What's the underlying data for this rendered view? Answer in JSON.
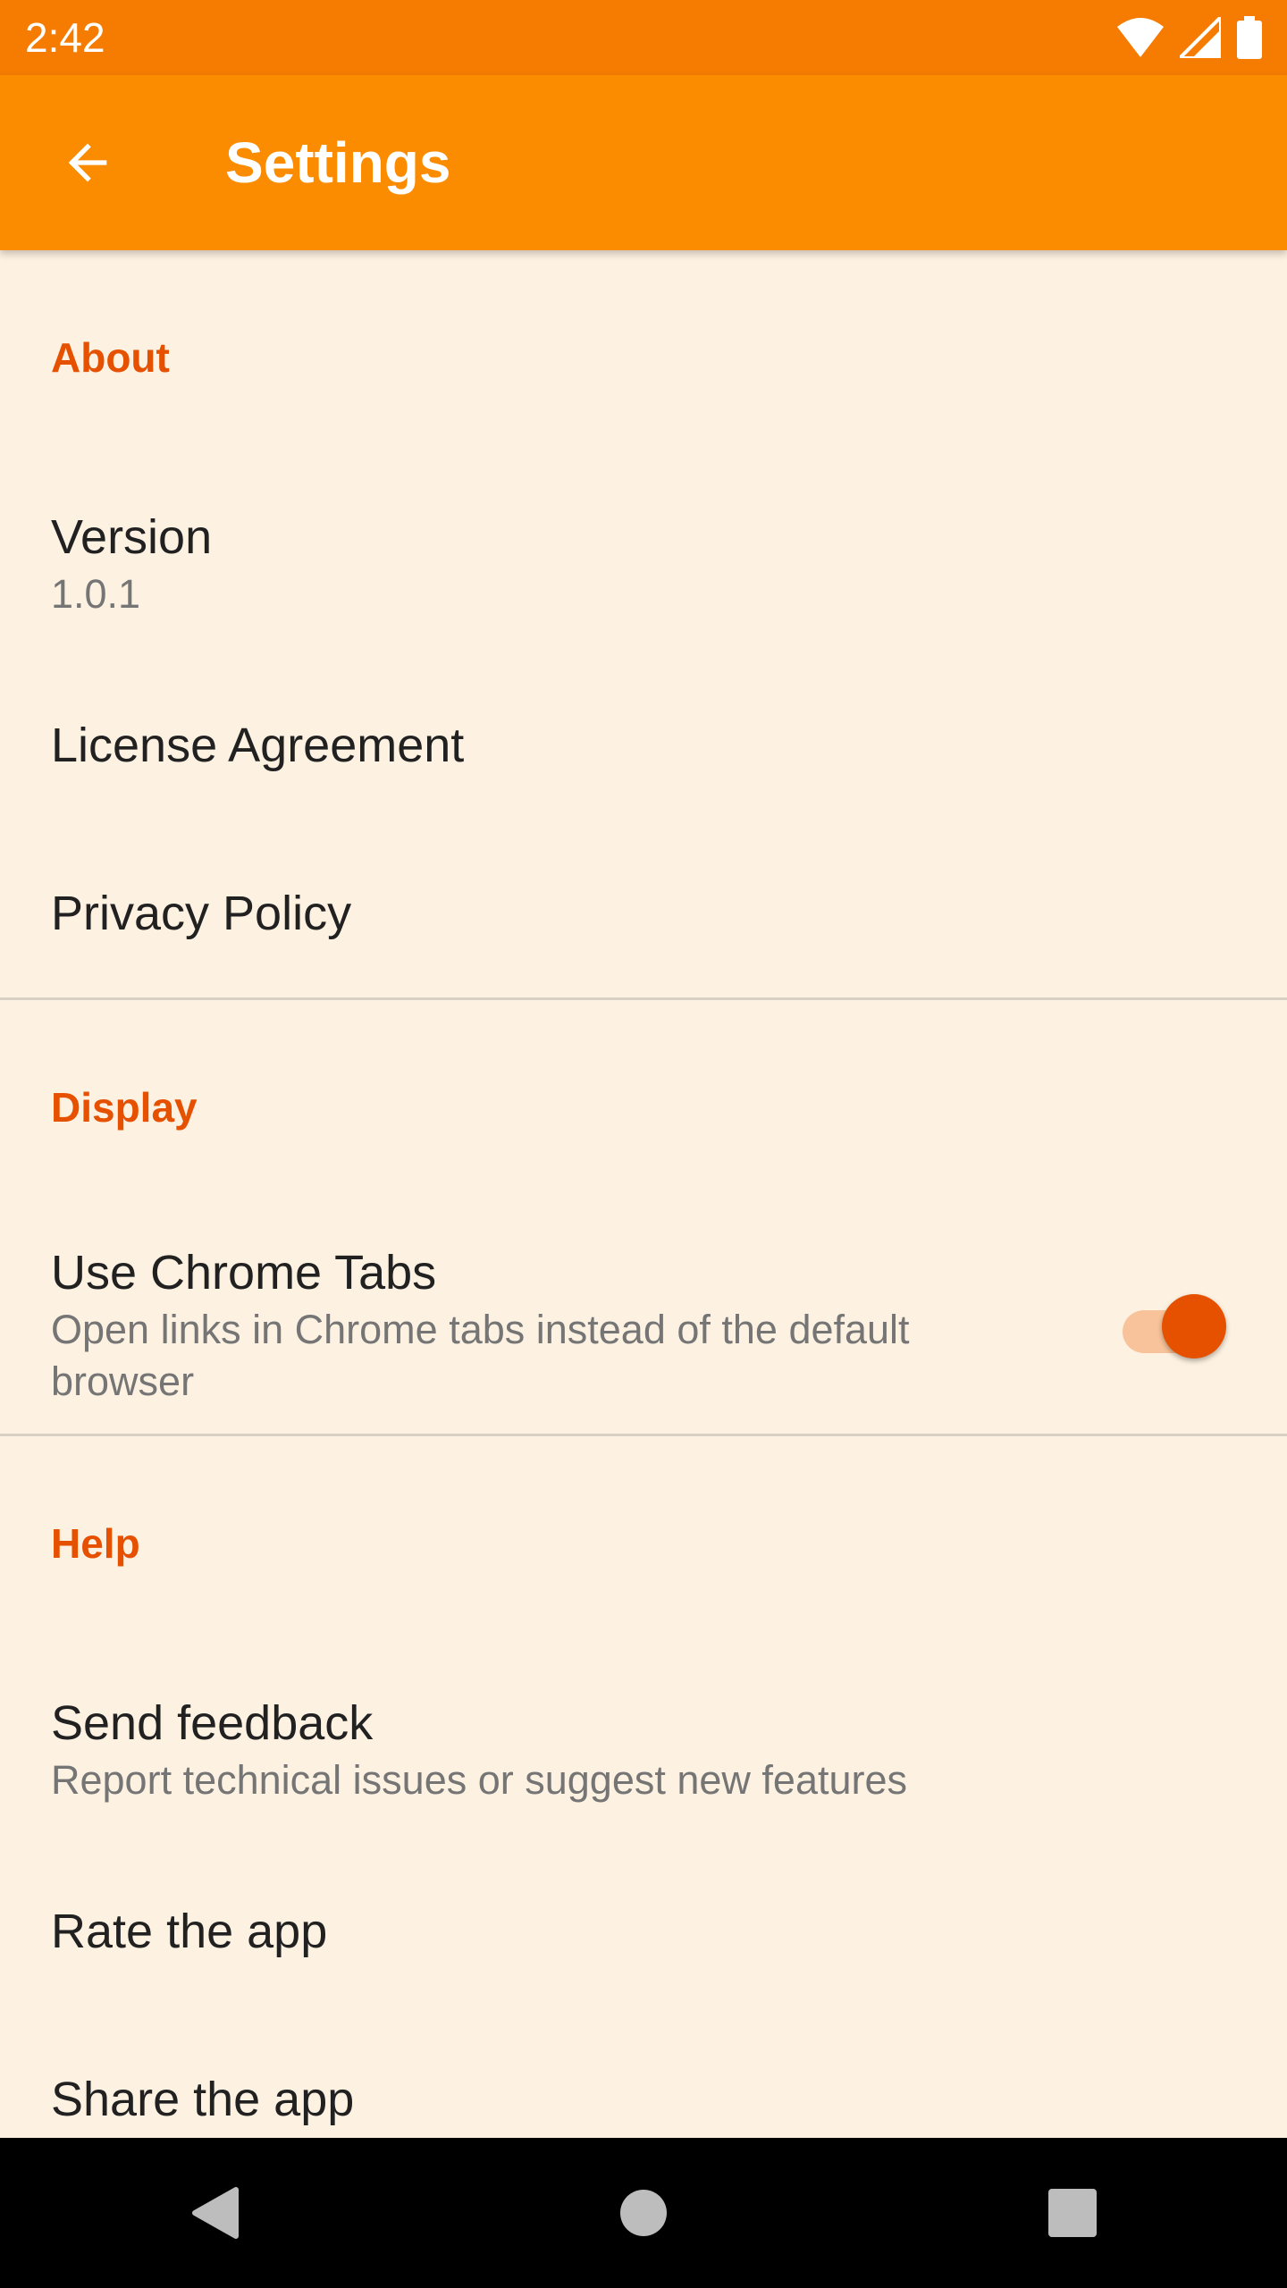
{
  "status_bar": {
    "time": "2:42",
    "icons": [
      "wifi-icon",
      "signal-icon",
      "battery-icon"
    ]
  },
  "app_bar": {
    "back_icon": "arrow-back-icon",
    "title": "Settings",
    "background": "#FB8C00"
  },
  "sections": {
    "about": {
      "header": "About",
      "version": {
        "title": "Version",
        "summary": "1.0.1"
      },
      "license": {
        "title": "License Agreement"
      },
      "privacy": {
        "title": "Privacy Policy"
      }
    },
    "display": {
      "header": "Display",
      "chrome_tabs": {
        "title": "Use Chrome Tabs",
        "summary": "Open links in Chrome tabs instead of the default browser",
        "enabled": true
      }
    },
    "help": {
      "header": "Help",
      "feedback": {
        "title": "Send feedback",
        "summary": "Report technical issues or suggest new features"
      },
      "rate": {
        "title": "Rate the app"
      },
      "share": {
        "title": "Share the app"
      }
    }
  },
  "nav_bar": {
    "icons": [
      "back-triangle-icon",
      "home-circle-icon",
      "recents-square-icon"
    ]
  },
  "colors": {
    "accent": "#E65100",
    "status_bar": "#F57C00",
    "background": "#FDF1E1"
  }
}
